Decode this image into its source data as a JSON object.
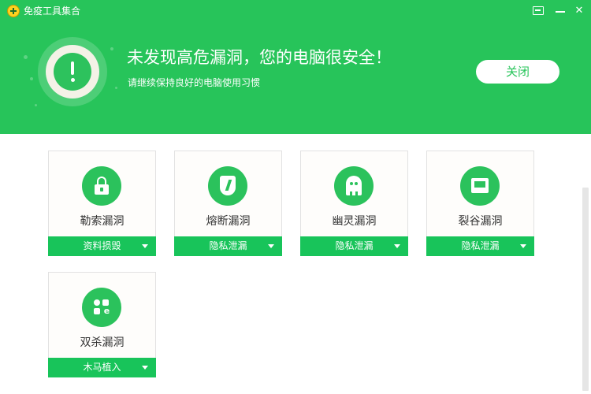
{
  "titlebar": {
    "app_title": "免疫工具集合",
    "min_symbol": "—",
    "close_symbol": "✕"
  },
  "banner": {
    "headline": "未发现高危漏洞，您的电脑很安全！",
    "subline": "请继续保持良好的电脑使用习惯",
    "close_button": "关闭"
  },
  "cards": [
    {
      "title": "勒索漏洞",
      "tag": "资料损毁",
      "icon": "lock-icon"
    },
    {
      "title": "熔断漏洞",
      "tag": "隐私泄漏",
      "icon": "shield-bolt-icon"
    },
    {
      "title": "幽灵漏洞",
      "tag": "隐私泄漏",
      "icon": "ghost-icon"
    },
    {
      "title": "裂谷漏洞",
      "tag": "隐私泄漏",
      "icon": "screen-icon"
    },
    {
      "title": "双杀漏洞",
      "tag": "木马植入",
      "icon": "ie-apps-icon"
    }
  ],
  "colors": {
    "brand_green": "#27c45a",
    "tag_green": "#18c45a",
    "icon_green": "#2bc25c"
  }
}
